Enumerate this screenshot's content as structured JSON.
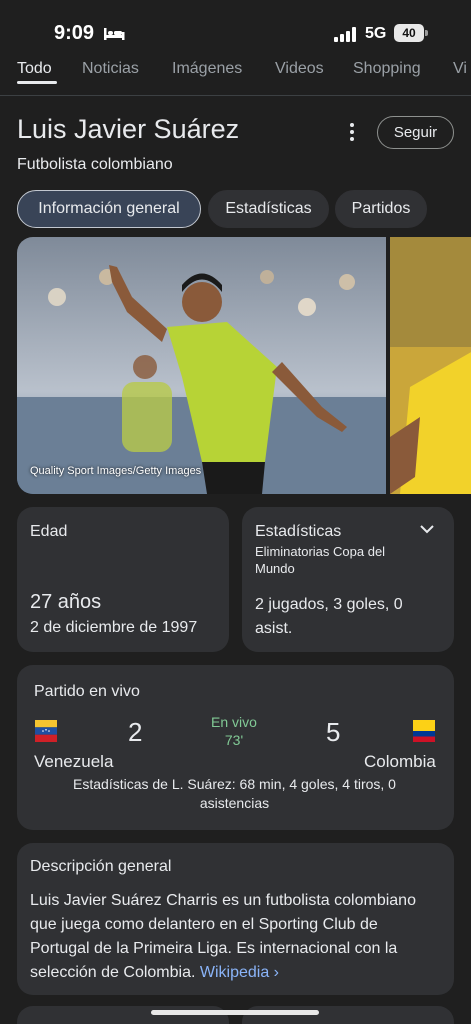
{
  "status": {
    "time": "9:09",
    "network": "5G",
    "battery": "40"
  },
  "tabs": [
    {
      "label": "Todo"
    },
    {
      "label": "Noticias"
    },
    {
      "label": "Imágenes"
    },
    {
      "label": "Videos"
    },
    {
      "label": "Shopping"
    },
    {
      "label": "Vi"
    }
  ],
  "entity": {
    "title": "Luis Javier Suárez",
    "subtitle": "Futbolista colombiano",
    "follow_label": "Seguir"
  },
  "chips": [
    {
      "label": "Información general"
    },
    {
      "label": "Estadísticas"
    },
    {
      "label": "Partidos"
    }
  ],
  "images": {
    "credit": "Quality Sport Images/Getty Images"
  },
  "age_card": {
    "label": "Edad",
    "value": "27 años",
    "date": "2 de diciembre de 1997"
  },
  "stats_card": {
    "label": "Estadísticas",
    "subtitle": "Eliminatorias Copa del Mundo",
    "value": "2 jugados, 3 goles, 0 asist."
  },
  "live_match": {
    "label": "Partido en vivo",
    "home_team": "Venezuela",
    "home_score": "2",
    "away_team": "Colombia",
    "away_score": "5",
    "status": "En vivo",
    "minute": "73'",
    "player_stats": "Estadísticas de L. Suárez: 68 min, 4 goles, 4 tiros, 0 asistencias"
  },
  "description": {
    "label": "Descripción general",
    "text": "Luis Javier Suárez Charris es un futbolista colombiano que juega como delantero en el Sporting Club de Portugal de la Primeira Liga. Es internacional con la selección de Colombia. ",
    "link": "Wikipedia ›"
  }
}
